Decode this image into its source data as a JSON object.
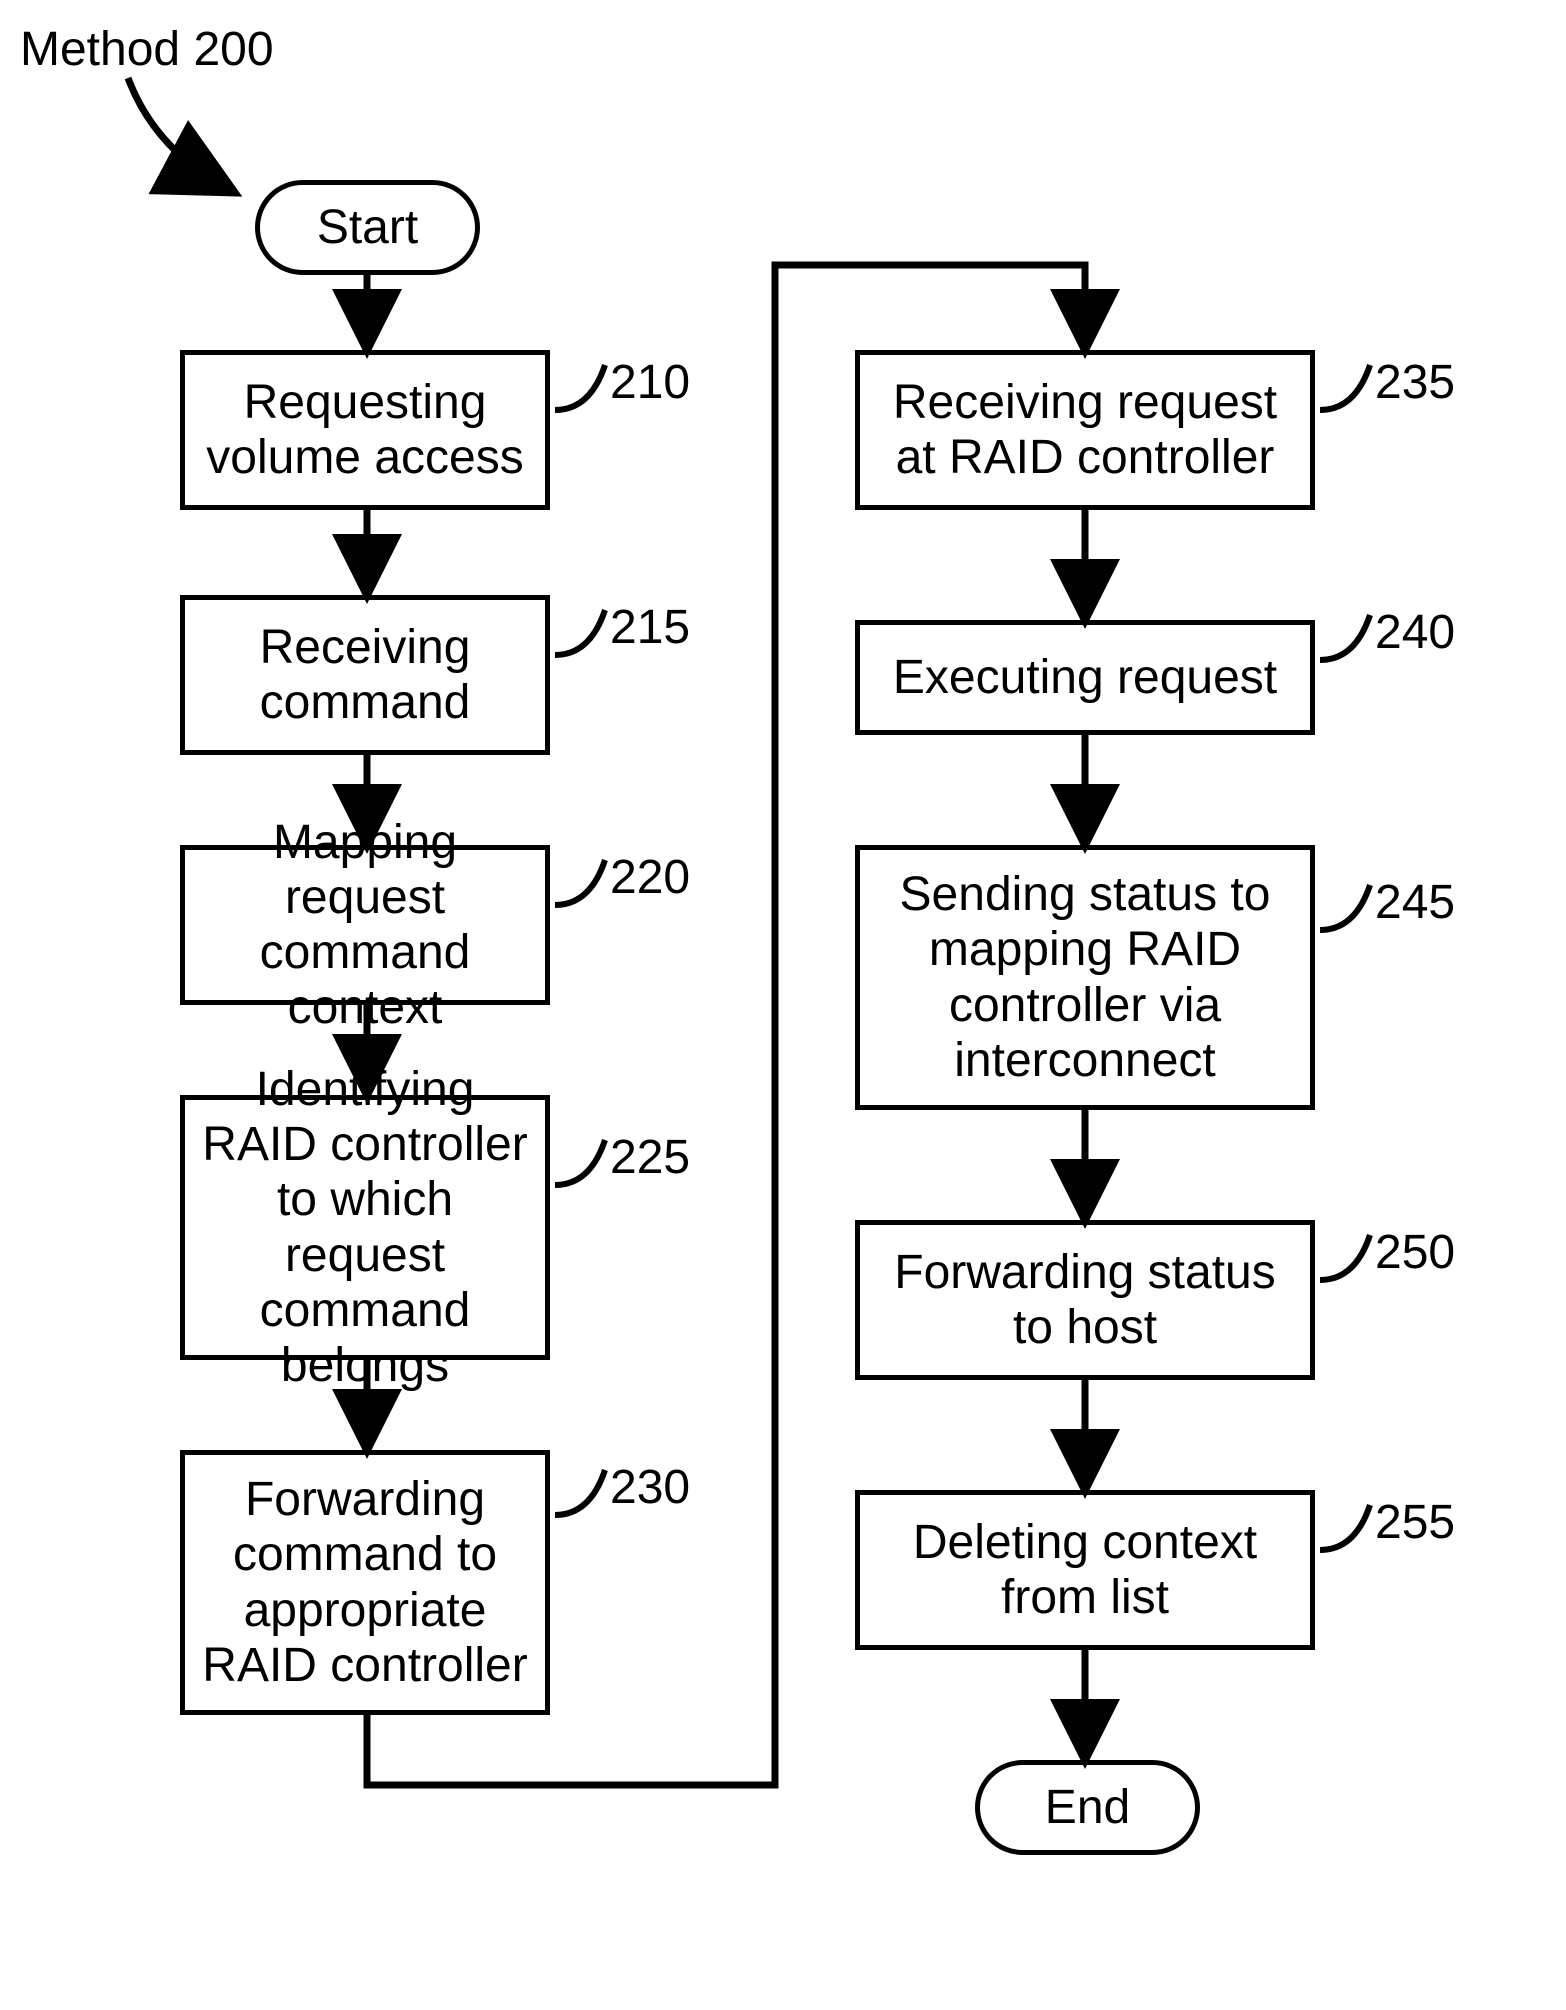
{
  "title": "Method 200",
  "terminators": {
    "start": "Start",
    "end": "End"
  },
  "steps": [
    {
      "num": "210",
      "text": "Requesting volume access"
    },
    {
      "num": "215",
      "text": "Receiving command"
    },
    {
      "num": "220",
      "text": "Mapping request command context"
    },
    {
      "num": "225",
      "text": "Identifying RAID controller to which request command belongs"
    },
    {
      "num": "230",
      "text": "Forwarding command to appropriate RAID controller"
    },
    {
      "num": "235",
      "text": "Receiving request at RAID controller"
    },
    {
      "num": "240",
      "text": "Executing request"
    },
    {
      "num": "245",
      "text": "Sending status to mapping RAID controller via interconnect"
    },
    {
      "num": "250",
      "text": "Forwarding status to host"
    },
    {
      "num": "255",
      "text": "Deleting context from list"
    }
  ]
}
